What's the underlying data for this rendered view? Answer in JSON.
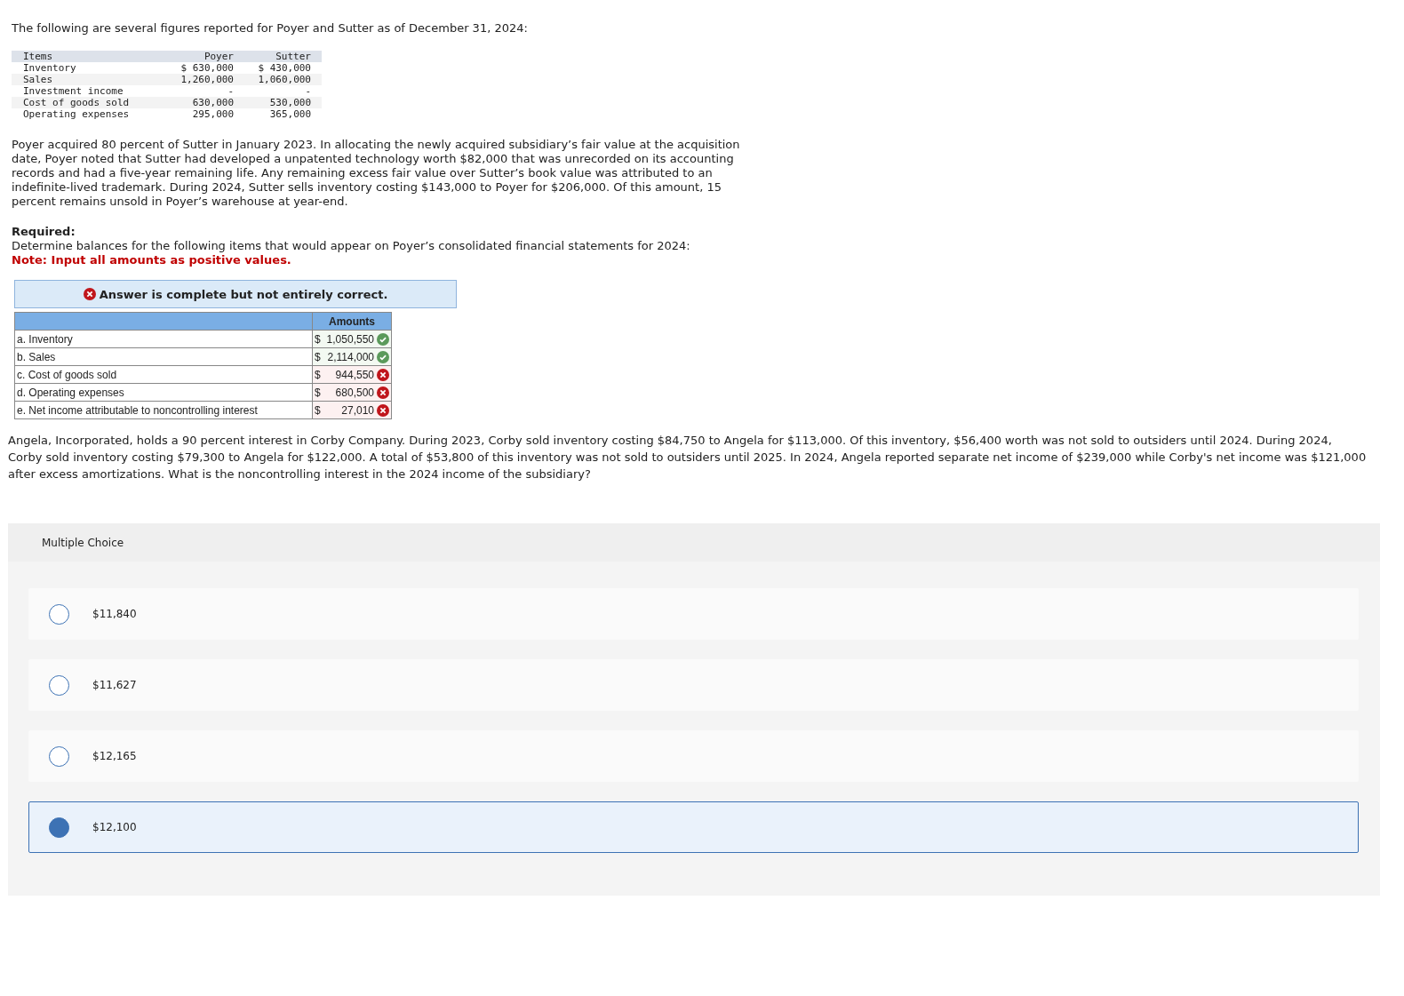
{
  "intro": "The following are several figures reported for Poyer and Sutter as of December 31, 2024:",
  "figures": {
    "columns": [
      "Items",
      "Poyer",
      "Sutter"
    ],
    "rows": [
      [
        "Inventory",
        "$ 630,000",
        "$ 430,000"
      ],
      [
        "Sales",
        "1,260,000",
        "1,060,000"
      ],
      [
        "Investment income",
        "-",
        "-"
      ],
      [
        "Cost of goods sold",
        "630,000",
        "530,000"
      ],
      [
        "Operating expenses",
        "295,000",
        "365,000"
      ]
    ]
  },
  "scenario": "Poyer acquired 80 percent of Sutter in January 2023. In allocating the newly acquired subsidiary’s fair value at the acquisition date, Poyer noted that Sutter had developed a unpatented technology worth $82,000 that was unrecorded on its accounting records and had a five-year remaining life. Any remaining excess fair value over Sutter’s book value was attributed to an indefinite-lived trademark. During 2024, Sutter sells inventory costing $143,000 to Poyer for $206,000. Of this amount, 15 percent remains unsold in Poyer’s warehouse at year-end.",
  "required_label": "Required:",
  "required_text": "Determine balances for the following items that would appear on Poyer’s consolidated financial statements for 2024:",
  "note": "Note: Input all amounts as positive values.",
  "result_banner": {
    "correct": false,
    "text": "Answer is complete but not entirely correct."
  },
  "answers": {
    "amount_header": "Amounts",
    "rows": [
      {
        "label": "a. Inventory",
        "currency": "$",
        "value": "1,050,550",
        "correct": true
      },
      {
        "label": "b. Sales",
        "currency": "$",
        "value": "2,114,000",
        "correct": true
      },
      {
        "label": "c. Cost of goods sold",
        "currency": "$",
        "value": "944,550",
        "correct": false
      },
      {
        "label": "d. Operating expenses",
        "currency": "$",
        "value": "680,500",
        "correct": false
      },
      {
        "label": "e. Net income attributable to noncontrolling interest",
        "currency": "$",
        "value": "27,010",
        "correct": false
      }
    ]
  },
  "question": "Angela, Incorporated, holds a 90 percent interest in Corby Company. During 2023, Corby sold inventory costing $84,750 to Angela for $113,000. Of this inventory, $56,400 worth was not sold to outsiders until 2024. During 2024, Corby sold inventory costing $79,300 to Angela for $122,000. A total of $53,800 of this inventory was not sold to outsiders until 2025. In 2024, Angela reported separate net income of $239,000 while Corby's net income was $121,000 after excess amortizations. What is the noncontrolling interest in the 2024 income of the subsidiary?",
  "multiple_choice": {
    "title": "Multiple Choice",
    "options": [
      {
        "label": "$11,840",
        "selected": false
      },
      {
        "label": "$11,627",
        "selected": false
      },
      {
        "label": "$12,165",
        "selected": false
      },
      {
        "label": "$12,100",
        "selected": true
      }
    ]
  }
}
